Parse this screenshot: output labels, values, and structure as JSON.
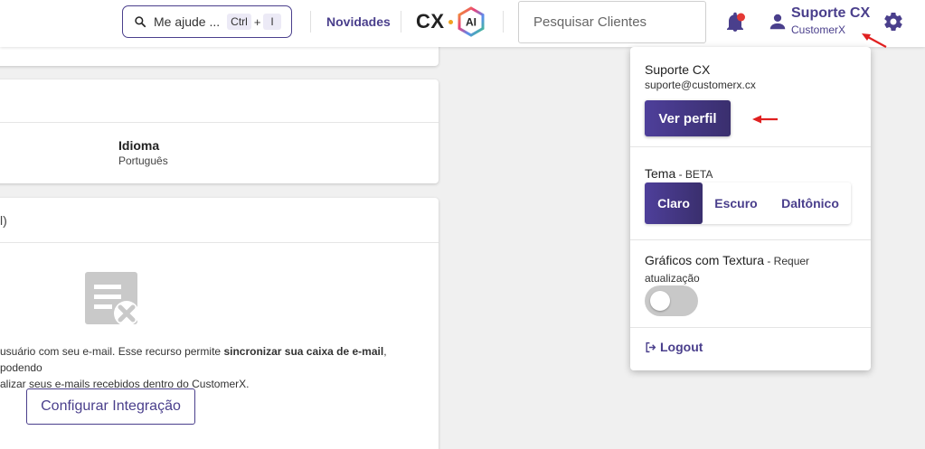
{
  "header": {
    "help_search": {
      "placeholder": "Me ajude ...",
      "shortcut_key1": "Ctrl",
      "shortcut_plus": "+",
      "shortcut_key2": "I"
    },
    "news_label": "Novidades",
    "logo": {
      "text": "CX",
      "badge": "AI"
    },
    "client_search": {
      "placeholder": "Pesquisar Clientes"
    },
    "user": {
      "name": "Suporte CX",
      "org": "CustomerX"
    }
  },
  "cards": {
    "language": {
      "label": "Idioma",
      "value": "Português"
    },
    "email_integration": {
      "title_fragment": "l)",
      "desc_line1_a": "usuário com seu e-mail. Esse recurso permite ",
      "desc_line1_bold": "sincronizar sua caixa de e-mail",
      "desc_line1_b": ", podendo",
      "desc_line2": "alizar seus e-mails recebidos dentro do CustomerX.",
      "button_label": "Configurar Integração"
    }
  },
  "dropdown": {
    "name": "Suporte CX",
    "email": "suporte@customerx.cx",
    "profile_button": "Ver perfil",
    "theme_label": "Tema",
    "theme_beta": " - BETA",
    "theme_options": [
      "Claro",
      "Escuro",
      "Daltônico"
    ],
    "theme_selected": "Claro",
    "texture_label": "Gráficos com Textura",
    "texture_note": " - Requer atualização",
    "texture_enabled": false,
    "logout_label": "Logout"
  },
  "colors": {
    "accent": "#4a3f8c",
    "notification": "#e53935",
    "annotation_arrow": "#e02020"
  }
}
